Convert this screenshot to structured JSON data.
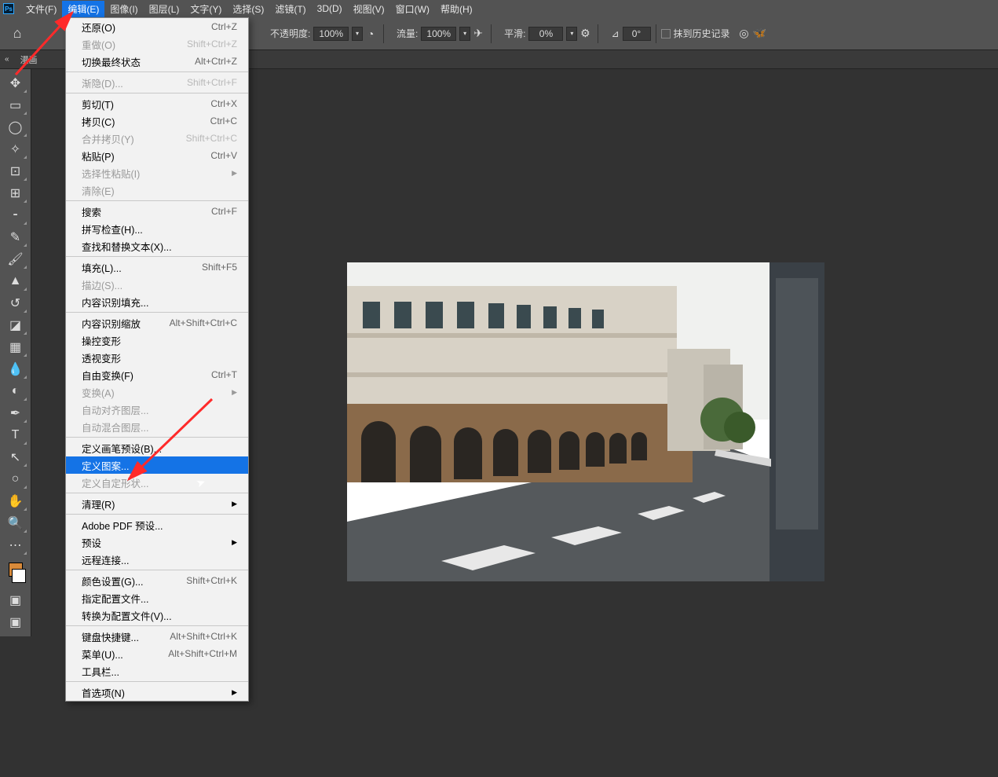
{
  "menubar": {
    "items": [
      {
        "label": "文件(F)"
      },
      {
        "label": "编辑(E)"
      },
      {
        "label": "图像(I)"
      },
      {
        "label": "图层(L)"
      },
      {
        "label": "文字(Y)"
      },
      {
        "label": "选择(S)"
      },
      {
        "label": "滤镜(T)"
      },
      {
        "label": "3D(D)"
      },
      {
        "label": "视图(V)"
      },
      {
        "label": "窗口(W)"
      },
      {
        "label": "帮助(H)"
      }
    ]
  },
  "optbar": {
    "opacity_label": "不透明度:",
    "opacity_val": "100%",
    "flow_label": "流量:",
    "flow_val": "100%",
    "smooth_label": "平滑:",
    "smooth_val": "0%",
    "angle_sym": "⊿",
    "angle_val": "0°",
    "history_label": "抹到历史记录"
  },
  "doctab": {
    "label": "漫画"
  },
  "dropdown": {
    "items": [
      {
        "label": "还原(O)",
        "sc": "Ctrl+Z"
      },
      {
        "label": "重做(O)",
        "sc": "Shift+Ctrl+Z",
        "disabled": true
      },
      {
        "label": "切换最终状态",
        "sc": "Alt+Ctrl+Z"
      },
      {
        "sep": true
      },
      {
        "label": "渐隐(D)...",
        "sc": "Shift+Ctrl+F",
        "disabled": true
      },
      {
        "sep": true
      },
      {
        "label": "剪切(T)",
        "sc": "Ctrl+X"
      },
      {
        "label": "拷贝(C)",
        "sc": "Ctrl+C"
      },
      {
        "label": "合并拷贝(Y)",
        "sc": "Shift+Ctrl+C",
        "disabled": true
      },
      {
        "label": "粘贴(P)",
        "sc": "Ctrl+V"
      },
      {
        "label": "选择性粘贴(I)",
        "sub": true,
        "disabled": true
      },
      {
        "label": "清除(E)",
        "disabled": true
      },
      {
        "sep": true
      },
      {
        "label": "搜索",
        "sc": "Ctrl+F"
      },
      {
        "label": "拼写检查(H)..."
      },
      {
        "label": "查找和替换文本(X)..."
      },
      {
        "sep": true
      },
      {
        "label": "填充(L)...",
        "sc": "Shift+F5"
      },
      {
        "label": "描边(S)...",
        "disabled": true
      },
      {
        "label": "内容识别填充..."
      },
      {
        "sep": true
      },
      {
        "label": "内容识别缩放",
        "sc": "Alt+Shift+Ctrl+C"
      },
      {
        "label": "操控变形"
      },
      {
        "label": "透视变形"
      },
      {
        "label": "自由变换(F)",
        "sc": "Ctrl+T"
      },
      {
        "label": "变换(A)",
        "sub": true,
        "disabled": true
      },
      {
        "label": "自动对齐图层...",
        "disabled": true
      },
      {
        "label": "自动混合图层...",
        "disabled": true
      },
      {
        "sep": true
      },
      {
        "label": "定义画笔预设(B)..."
      },
      {
        "label": "定义图案...",
        "hover": true
      },
      {
        "label": "定义自定形状...",
        "disabled": true
      },
      {
        "sep": true
      },
      {
        "label": "清理(R)",
        "sub": true
      },
      {
        "sep": true
      },
      {
        "label": "Adobe PDF 预设..."
      },
      {
        "label": "预设",
        "sub": true
      },
      {
        "label": "远程连接..."
      },
      {
        "sep": true
      },
      {
        "label": "颜色设置(G)...",
        "sc": "Shift+Ctrl+K"
      },
      {
        "label": "指定配置文件..."
      },
      {
        "label": "转换为配置文件(V)..."
      },
      {
        "sep": true
      },
      {
        "label": "键盘快捷键...",
        "sc": "Alt+Shift+Ctrl+K"
      },
      {
        "label": "菜单(U)...",
        "sc": "Alt+Shift+Ctrl+M"
      },
      {
        "label": "工具栏..."
      },
      {
        "sep": true
      },
      {
        "label": "首选项(N)",
        "sub": true
      }
    ]
  },
  "tools": [
    {
      "name": "move-tool",
      "glyph": "✥"
    },
    {
      "name": "marquee-tool",
      "glyph": "▭"
    },
    {
      "name": "lasso-tool",
      "glyph": "◯"
    },
    {
      "name": "magic-wand-tool",
      "glyph": "✧"
    },
    {
      "name": "crop-tool",
      "glyph": "⊡"
    },
    {
      "name": "frame-tool",
      "glyph": "⊞"
    },
    {
      "name": "eyedropper-tool",
      "glyph": "⁃"
    },
    {
      "name": "healing-brush-tool",
      "glyph": "✎"
    },
    {
      "name": "brush-tool",
      "glyph": "🖌"
    },
    {
      "name": "clone-stamp-tool",
      "glyph": "▲"
    },
    {
      "name": "history-brush-tool",
      "glyph": "↺"
    },
    {
      "name": "eraser-tool",
      "glyph": "◪"
    },
    {
      "name": "gradient-tool",
      "glyph": "▦"
    },
    {
      "name": "blur-tool",
      "glyph": "💧"
    },
    {
      "name": "dodge-tool",
      "glyph": "◐"
    },
    {
      "name": "pen-tool",
      "glyph": "✒"
    },
    {
      "name": "type-tool",
      "glyph": "T"
    },
    {
      "name": "path-select-tool",
      "glyph": "↖"
    },
    {
      "name": "shape-tool",
      "glyph": "○"
    },
    {
      "name": "hand-tool",
      "glyph": "✋"
    },
    {
      "name": "zoom-tool",
      "glyph": "🔍"
    },
    {
      "name": "more-tools",
      "glyph": "⋯"
    }
  ]
}
